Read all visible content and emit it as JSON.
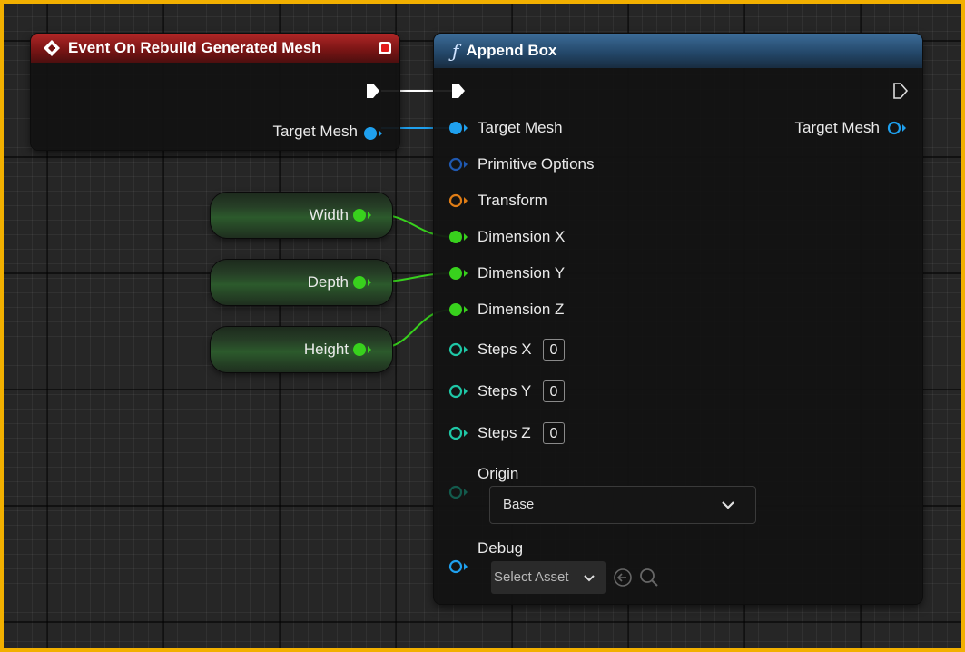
{
  "event_node": {
    "title": "Event On Rebuild Generated Mesh",
    "output_pin_label": "Target Mesh",
    "title_color": "#8b1b1b"
  },
  "append_node": {
    "title": "Append Box",
    "title_color": "#2f5a82",
    "input_pins": [
      {
        "label": "Target Mesh",
        "type": "object",
        "color": "#1fa0ee"
      },
      {
        "label": "Primitive Options",
        "type": "struct",
        "color": "#1f58b0"
      },
      {
        "label": "Transform",
        "type": "transform",
        "color": "#e07d16"
      },
      {
        "label": "Dimension X",
        "type": "float",
        "color": "#38d11d"
      },
      {
        "label": "Dimension Y",
        "type": "float",
        "color": "#38d11d"
      },
      {
        "label": "Dimension Z",
        "type": "float",
        "color": "#38d11d"
      },
      {
        "label": "Steps X",
        "type": "int",
        "color": "#1fc7a6",
        "value": "0"
      },
      {
        "label": "Steps Y",
        "type": "int",
        "color": "#1fc7a6",
        "value": "0"
      },
      {
        "label": "Steps Z",
        "type": "int",
        "color": "#1fc7a6",
        "value": "0"
      }
    ],
    "origin": {
      "label": "Origin",
      "value": "Base"
    },
    "debug": {
      "label": "Debug",
      "select_label": "Select Asset"
    },
    "output_pin_label": "Target Mesh"
  },
  "variables": [
    {
      "name": "Width"
    },
    {
      "name": "Depth"
    },
    {
      "name": "Height"
    }
  ]
}
